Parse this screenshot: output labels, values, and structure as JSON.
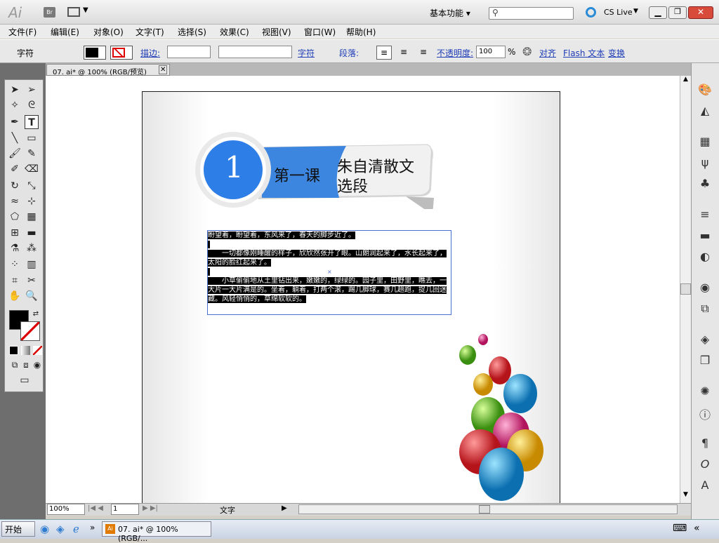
{
  "app": {
    "logo": "Ai",
    "bridge": "Br",
    "workspace": "基本功能 ▾",
    "search_placeholder": "",
    "cs_live": "CS Live"
  },
  "menu": [
    "文件(F)",
    "编辑(E)",
    "对象(O)",
    "文字(T)",
    "选择(S)",
    "效果(C)",
    "视图(V)",
    "窗口(W)",
    "帮助(H)"
  ],
  "control": {
    "type_label": "字符",
    "stroke_label": "描边:",
    "char_link": "字符",
    "para_label": "段落:",
    "opacity_label": "不透明度:",
    "opacity_value": "100",
    "percent": "%",
    "align_link": "对齐",
    "flash_link": "Flash 文本",
    "transform_link": "变换"
  },
  "doc_tab": "07. ai* @ 100% (RGB/预览)",
  "artwork": {
    "number": "1",
    "lesson": "第一课",
    "title_line1": "朱自清散文",
    "title_line2": "选段"
  },
  "text_block": [
    "盼望着，盼望着，东风来了，春天的脚步近了。",
    "",
    "　　一切都像刚睡醒的样子，欣欣然张开了眼。山朗润起来了，水长起来了，太阳的脸红起来了。",
    "",
    "　　小草偷偷地从土里钻出来，嫩嫩的，绿绿的。园子里，田野里，瞧去，一大片一大片满是的。坐着，躺着，打两个滚，踢几脚球，赛几趟跑，捉几回迷藏。风轻悄悄的，草绵软软的。"
  ],
  "status": {
    "zoom": "100%",
    "page": "1",
    "mode": "文字"
  },
  "taskbar": {
    "start": "开始",
    "task": "07. ai* @ 100% (RGB/..."
  }
}
